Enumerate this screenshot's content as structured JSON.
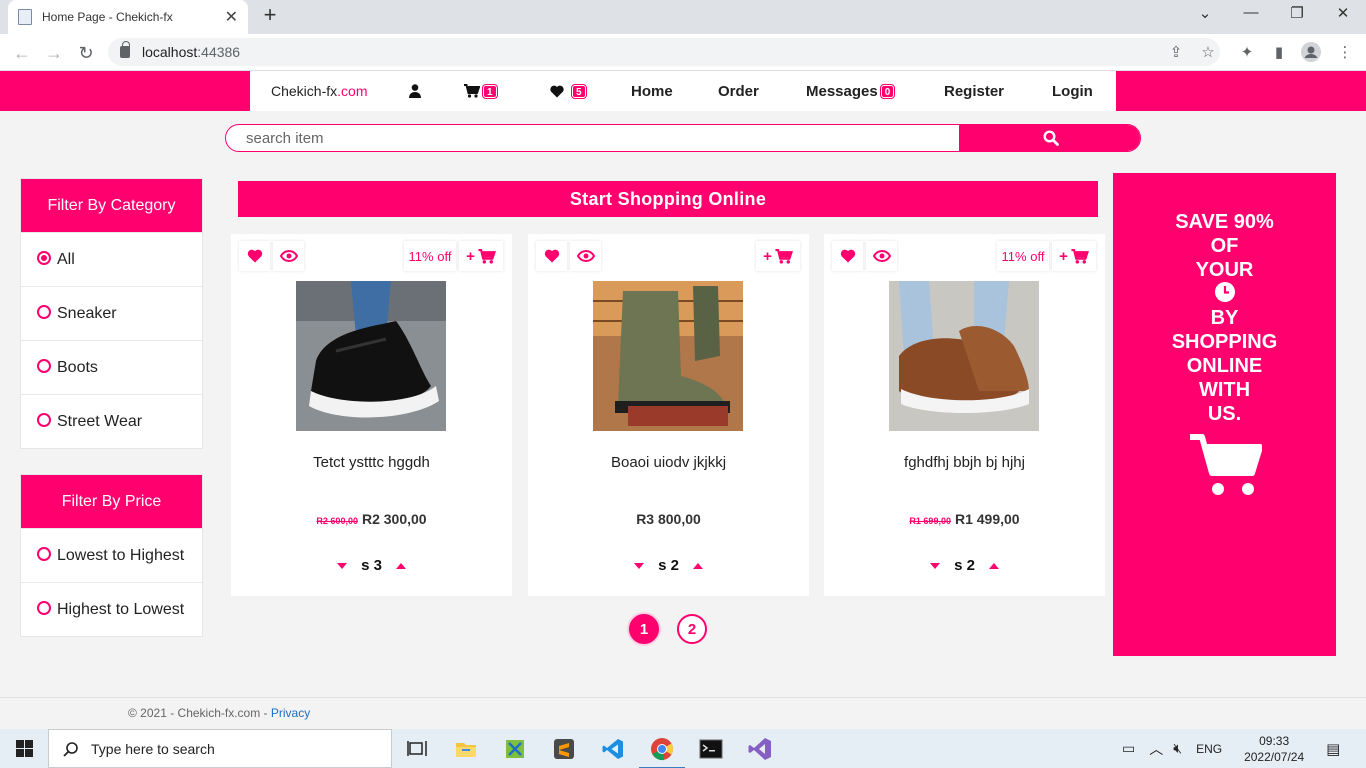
{
  "browser": {
    "tab_title": "Home Page - Chekich-fx",
    "tab_close": "✕",
    "new_tab": "+",
    "url_host": "localhost",
    "url_port": ":44386"
  },
  "nav": {
    "brand_main": "Chekich-fx",
    "brand_tld": ".com",
    "cart_count": "1",
    "wishlist_count": "5",
    "home": "Home",
    "order": "Order",
    "messages": "Messages",
    "messages_count": "0",
    "register": "Register",
    "login": "Login"
  },
  "search": {
    "placeholder": "search item"
  },
  "category_filter": {
    "title": "Filter By Category",
    "options": [
      {
        "label": "All",
        "checked": true
      },
      {
        "label": "Sneaker",
        "checked": false
      },
      {
        "label": "Boots",
        "checked": false
      },
      {
        "label": "Street Wear",
        "checked": false
      }
    ]
  },
  "price_filter": {
    "title": "Filter By Price",
    "options": [
      {
        "label": "Lowest to Highest",
        "checked": false
      },
      {
        "label": "Highest to Lowest",
        "checked": false
      }
    ]
  },
  "banner": "Start Shopping Online",
  "products": [
    {
      "name": "Tetct ystttc hggdh",
      "discount": "11% off",
      "old_price": "R2 600,00",
      "price": "R2 300,00",
      "size": "s 3",
      "add_label": "+"
    },
    {
      "name": "Boaoi uiodv jkjkkj",
      "discount": "",
      "old_price": "",
      "price": "R3 800,00",
      "size": "s 2",
      "add_label": "+"
    },
    {
      "name": "fghdfhj bbjh bj hjhj",
      "discount": "11% off",
      "old_price": "R1 699,00",
      "price": "R1 499,00",
      "size": "s 2",
      "add_label": "+"
    }
  ],
  "pagination": {
    "pages": [
      "1",
      "2"
    ],
    "active": "1"
  },
  "ad": {
    "lines": [
      "SAVE 90%",
      "OF",
      "YOUR",
      "BY",
      "SHOPPING",
      "ONLINE",
      "WITH",
      "US."
    ]
  },
  "footer": {
    "text": "© 2021 - Chekich-fx.com - ",
    "privacy": "Privacy"
  },
  "taskbar": {
    "search_placeholder": "Type here to search",
    "lang": "ENG",
    "time": "09:33",
    "date": "2022/07/24"
  },
  "colors": {
    "accent": "#ff006e",
    "background": "#f3f3f3"
  },
  "icons": [
    "user-icon",
    "cart-icon",
    "heart-icon",
    "eye-icon",
    "search-icon",
    "clock-icon"
  ]
}
